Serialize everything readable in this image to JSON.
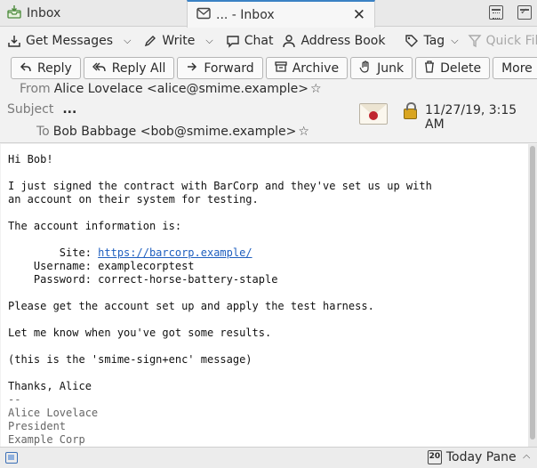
{
  "tabs": [
    {
      "label": "Inbox",
      "icon": "inbox-icon",
      "active": false
    },
    {
      "label": "... - Inbox",
      "icon": "envelope-icon",
      "active": true
    }
  ],
  "toolbar": {
    "get_messages": "Get Messages",
    "write": "Write",
    "chat": "Chat",
    "address_book": "Address Book",
    "tag": "Tag",
    "quick_filter": "Quick Filt"
  },
  "actions": {
    "reply": "Reply",
    "reply_all": "Reply All",
    "forward": "Forward",
    "archive": "Archive",
    "junk": "Junk",
    "delete": "Delete",
    "more": "More"
  },
  "header": {
    "from_label": "From",
    "from_value": "Alice Lovelace <alice@smime.example>",
    "subject_label": "Subject",
    "subject_value": "...",
    "to_label": "To",
    "to_value": "Bob Babbage <bob@smime.example>",
    "date": "11/27/19, 3:15 AM",
    "security": {
      "signed": true,
      "encrypted": true
    }
  },
  "body": {
    "greeting": "Hi Bob!",
    "para1_line1": "I just signed the contract with BarCorp and they've set us up with",
    "para1_line2": "an account on their system for testing.",
    "para2": "The account information is:",
    "site_label": "        Site: ",
    "site_url": "https://barcorp.example/",
    "username_line": "    Username: examplecorptest",
    "password_line": "    Password: correct-horse-battery-staple",
    "para3": "Please get the account set up and apply the test harness.",
    "para4": "Let me know when you've got some results.",
    "para5": "(this is the 'smime-sign+enc' message)",
    "closing": "Thanks, Alice",
    "sig_sep": "--",
    "sig_name": "Alice Lovelace",
    "sig_title": "President",
    "sig_company": "Example Corp"
  },
  "statusbar": {
    "today_pane": "Today Pane",
    "calendar_day": "20"
  }
}
